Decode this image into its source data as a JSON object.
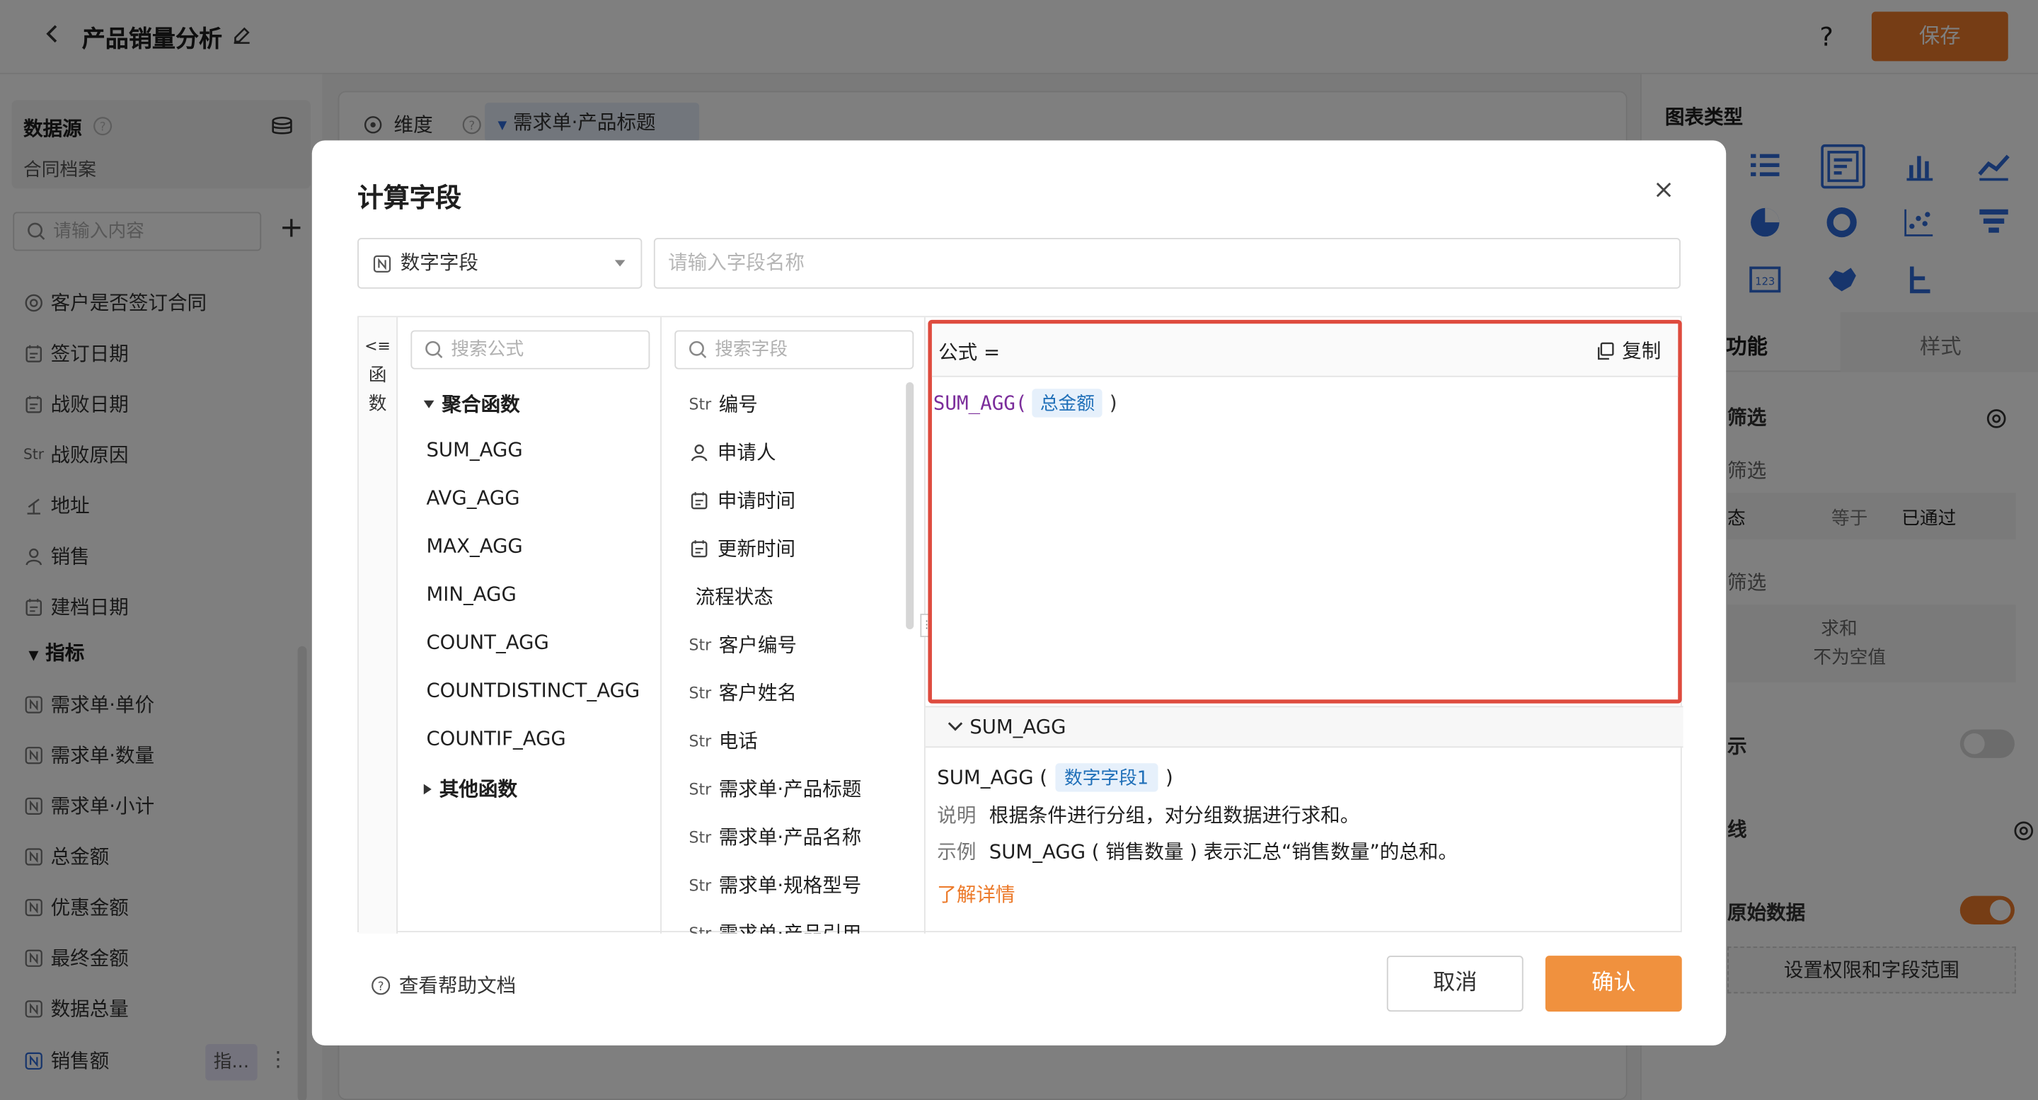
{
  "topbar": {
    "title": "产品销量分析",
    "help": "?",
    "save_label": "保存"
  },
  "left": {
    "datasource_title": "数据源",
    "datasource_name": "合同档案",
    "search_placeholder": "请输入内容",
    "dimension_items": [
      {
        "icon": "target-icon",
        "label": "客户是否签订合同"
      },
      {
        "icon": "calendar-icon",
        "label": "签订日期"
      },
      {
        "icon": "calendar-icon",
        "label": "战败日期"
      },
      {
        "icon": "str-tag",
        "tag": "Str",
        "label": "战败原因"
      },
      {
        "icon": "location-icon",
        "label": "地址"
      },
      {
        "icon": "user-icon",
        "label": "销售"
      },
      {
        "icon": "calendar-icon",
        "label": "建档日期"
      }
    ],
    "metrics_group": "指标",
    "metric_items": [
      "需求单·单价",
      "需求单·数量",
      "需求单·小计",
      "总金额",
      "优惠金额",
      "最终金额",
      "数据总量",
      "销售额"
    ],
    "indicator_badge": "指..."
  },
  "center": {
    "dimension_label": "维度",
    "dimension_tag": "需求单·产品标题"
  },
  "right": {
    "chart_type_title": "图表类型",
    "tab_function": "功能",
    "tab_style": "样式",
    "filter_label": "筛选",
    "filter_sub1": "筛选",
    "filter_row_a": "态",
    "filter_row_b": "等于",
    "filter_row_c": "已通过",
    "filter_sub2": "筛选",
    "agg_a": "求和",
    "agg_b": "不为空值",
    "display_label": "示",
    "line_label": "线",
    "raw_label": "原始数据",
    "perm_button": "设置权限和字段范围"
  },
  "modal": {
    "title": "计算字段",
    "field_type": "数字字段",
    "name_placeholder": "请输入字段名称",
    "fn_tab": "函数",
    "fn_search_placeholder": "搜索公式",
    "fn_group_agg": "聚合函数",
    "fn_items": [
      "SUM_AGG",
      "AVG_AGG",
      "MAX_AGG",
      "MIN_AGG",
      "COUNT_AGG",
      "COUNTDISTINCT_AGG",
      "COUNTIF_AGG"
    ],
    "fn_group_other": "其他函数",
    "field_search_placeholder": "搜索字段",
    "fields": [
      {
        "tag": "Str",
        "label": "编号"
      },
      {
        "tag": "user",
        "label": "申请人"
      },
      {
        "tag": "cal",
        "label": "申请时间"
      },
      {
        "tag": "cal",
        "label": "更新时间"
      },
      {
        "tag": "",
        "label": "流程状态"
      },
      {
        "tag": "Str",
        "label": "客户编号"
      },
      {
        "tag": "Str",
        "label": "客户姓名"
      },
      {
        "tag": "Str",
        "label": "电话"
      },
      {
        "tag": "Str",
        "label": "需求单·产品标题"
      },
      {
        "tag": "Str",
        "label": "需求单·产品名称"
      },
      {
        "tag": "Str",
        "label": "需求单·规格型号"
      },
      {
        "tag": "Str",
        "label": "需求单·产品引用"
      }
    ],
    "formula_label": "公式 =",
    "copy_label": "复制",
    "formula_fn": "SUM_AGG(",
    "formula_arg": "总金额",
    "formula_close": ")",
    "help_header": "SUM_AGG",
    "help_sig_fn": "SUM_AGG (",
    "help_sig_arg": "数字字段1",
    "help_sig_close": ")",
    "help_desc_key": "说明",
    "help_desc": "根据条件进行分组，对分组数据进行求和。",
    "help_example_key": "示例",
    "help_example": "SUM_AGG ( 销售数量 ) 表示汇总“销售数量”的总和。",
    "help_more": "了解详情",
    "doc_link": "查看帮助文档",
    "cancel_label": "取消",
    "ok_label": "确认"
  }
}
